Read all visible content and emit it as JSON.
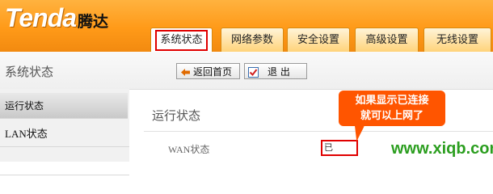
{
  "brand": {
    "name": "Tenda",
    "name_cn": "腾达"
  },
  "tabs": [
    {
      "label": "系统状态",
      "active": true
    },
    {
      "label": "网络参数",
      "active": false
    },
    {
      "label": "安全设置",
      "active": false
    },
    {
      "label": "高级设置",
      "active": false
    },
    {
      "label": "无线设置",
      "active": false
    }
  ],
  "toolbar": {
    "section_title": "系统状态",
    "home_button": "返回首页",
    "exit_button": "退 出"
  },
  "sidebar": {
    "items": [
      {
        "label": "运行状态",
        "active": true
      },
      {
        "label": "LAN状态",
        "active": false
      },
      {
        "label": "",
        "active": false
      }
    ]
  },
  "main": {
    "title": "运行状态",
    "wan_label": "WAN状态",
    "wan_value": "已"
  },
  "callout": {
    "line1": "如果显示已连接",
    "line2": "就可以上网了"
  },
  "watermark": "www.xiqb.com",
  "colors": {
    "header_orange": "#ff9a18",
    "highlight_red": "#e00000",
    "callout_orange": "#ff5500",
    "watermark_green": "#2b9e1f"
  }
}
